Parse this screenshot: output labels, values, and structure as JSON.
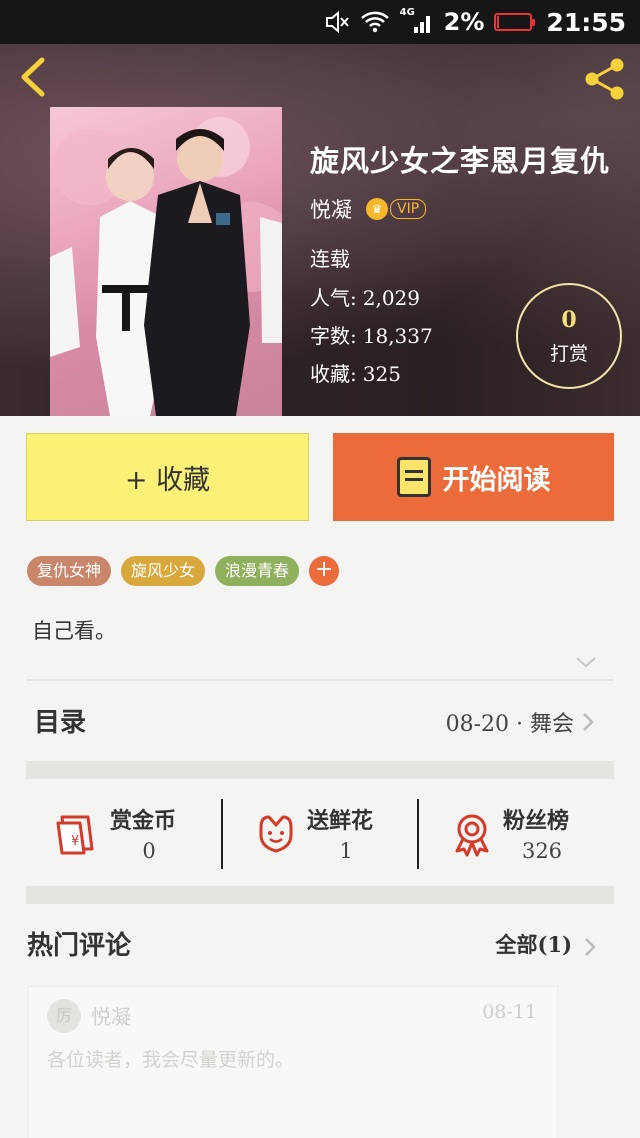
{
  "status_bar": {
    "battery_text": "2%",
    "battery_level": 0.02,
    "time": "21:55",
    "network_label": "4G",
    "icons": [
      "mute-icon",
      "wifi-icon",
      "signal-icon",
      "battery-icon"
    ],
    "battery_color": "#ee3333"
  },
  "header": {
    "back_icon": "back-arrow-icon",
    "share_icon": "share-icon",
    "accent_color": "#f5d23a"
  },
  "book": {
    "title": "旋风少女之李恩月复仇",
    "author": "悦凝",
    "vip_badge": "VIP",
    "status": "连载",
    "popularity_label": "人气:",
    "popularity": "2,029",
    "word_count_label": "字数:",
    "word_count": "18,337",
    "collect_count_label": "收藏:",
    "collect_count": "325"
  },
  "tip": {
    "count": "0",
    "label": "打赏"
  },
  "actions": {
    "collect_label": "+ 收藏",
    "read_label": "开始阅读",
    "collect_color": "#fbf176",
    "read_color": "#ec6b3a"
  },
  "tags": [
    {
      "label": "复仇女神",
      "color": "#c9866a"
    },
    {
      "label": "旋风少女",
      "color": "#d9a83c"
    },
    {
      "label": "浪漫青春",
      "color": "#8fb05c"
    }
  ],
  "tag_add": "+",
  "intro": "自己看。",
  "toc": {
    "title": "目录",
    "latest": "08-20 · 舞会"
  },
  "stats": [
    {
      "label": "赏金币",
      "value": "0",
      "icon": "red-envelope-icon"
    },
    {
      "label": "送鲜花",
      "value": "1",
      "icon": "flower-icon"
    },
    {
      "label": "粉丝榜",
      "value": "326",
      "icon": "medal-icon"
    }
  ],
  "comments": {
    "title": "热门评论",
    "all_label": "全部(1)",
    "items": [
      {
        "avatar_char": "厉",
        "user": "悦凝",
        "date": "08-11",
        "text": "各位读者，我会尽量更新的。"
      }
    ]
  }
}
